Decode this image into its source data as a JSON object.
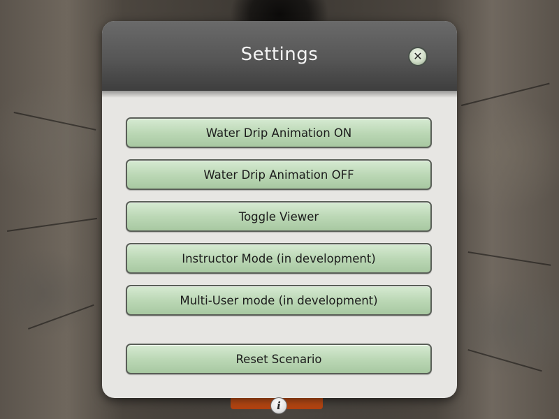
{
  "dialog": {
    "title": "Settings",
    "close_icon": "close-icon",
    "buttons": [
      {
        "label": "Water Drip Animation ON"
      },
      {
        "label": "Water Drip Animation OFF"
      },
      {
        "label": "Toggle Viewer"
      },
      {
        "label": "Instructor Mode (in development)"
      },
      {
        "label": "Multi-User mode (in development)"
      },
      {
        "label": "Reset Scenario"
      }
    ]
  },
  "bottom_bar": {
    "info_icon": "info-icon",
    "info_glyph": "i"
  },
  "colors": {
    "header": "#565656",
    "panel": "#e7e6e3",
    "button": "#bcd8b6",
    "accent_tab": "#c44c15"
  }
}
